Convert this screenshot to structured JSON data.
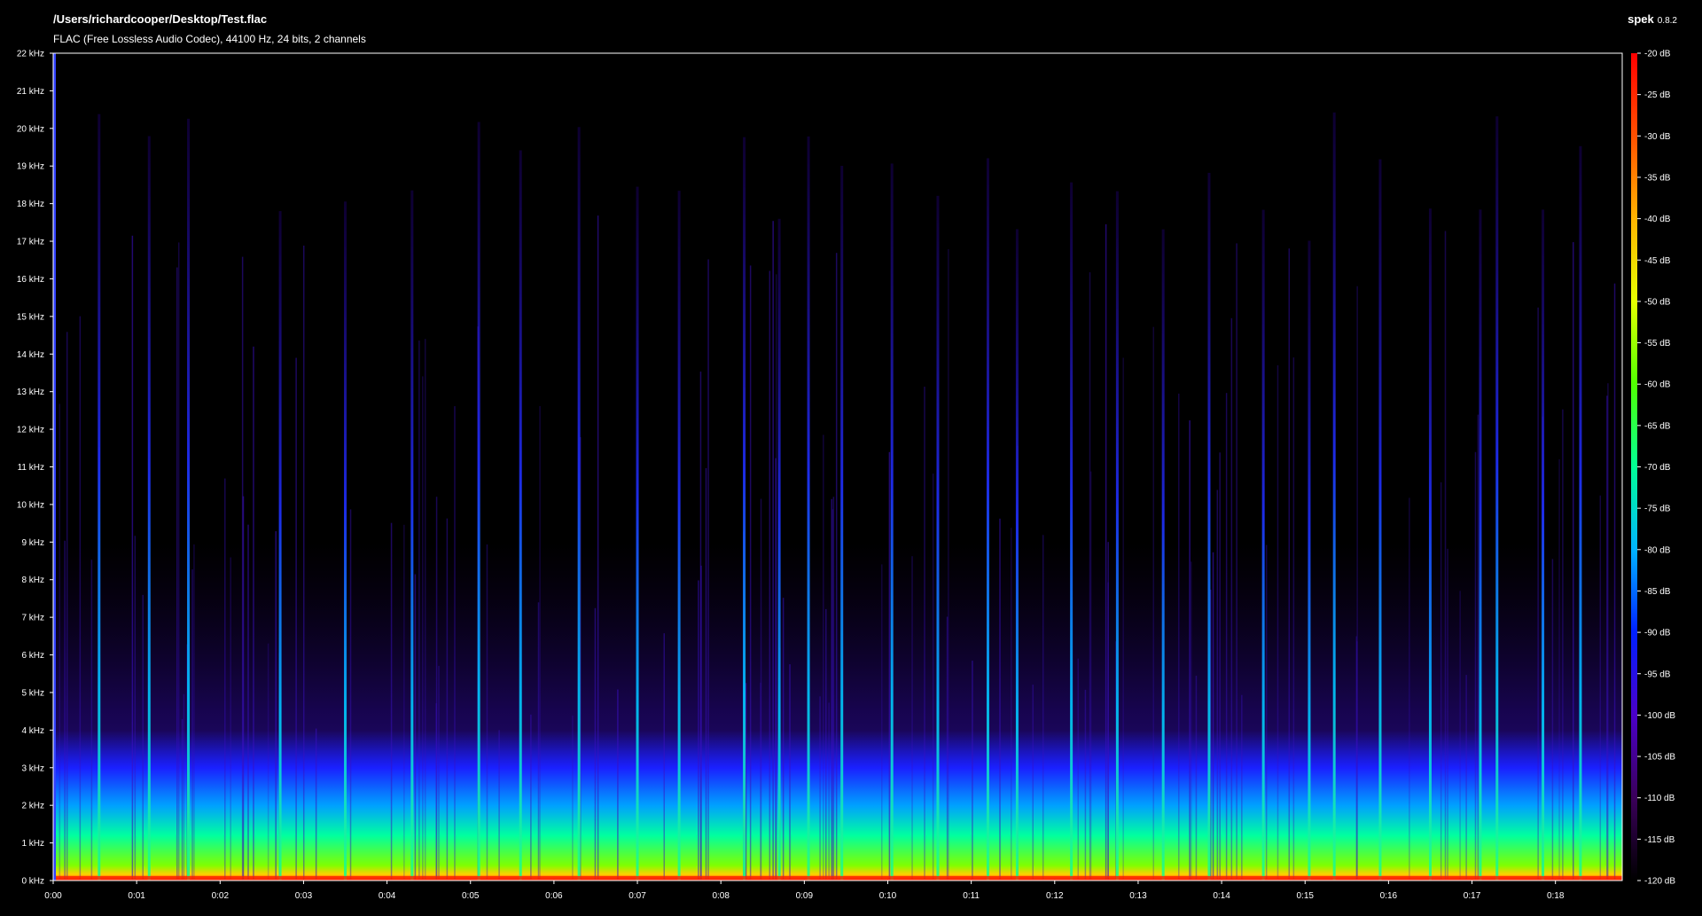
{
  "header": {
    "file_path": "/Users/richardcooper/Desktop/Test.flac",
    "stream_info": "FLAC (Free Lossless Audio Codec), 44100 Hz, 24 bits, 2 channels",
    "app_name": "spek",
    "app_version": "0.8.2"
  },
  "chart_data": {
    "type": "heatmap",
    "title": "",
    "xlabel": "",
    "ylabel": "",
    "x_ticks": [
      "0:00",
      "0:01",
      "0:02",
      "0:03",
      "0:04",
      "0:05",
      "0:06",
      "0:07",
      "0:08",
      "0:09",
      "0:10",
      "0:11",
      "0:12",
      "0:13",
      "0:14",
      "0:15",
      "0:16",
      "0:17",
      "0:18"
    ],
    "x_tick_seconds": [
      0,
      1,
      2,
      3,
      4,
      5,
      6,
      7,
      8,
      9,
      10,
      11,
      12,
      13,
      14,
      15,
      16,
      17,
      18
    ],
    "xlim_seconds": [
      0,
      18.8
    ],
    "y_ticks": [
      "0 kHz",
      "1 kHz",
      "2 kHz",
      "3 kHz",
      "4 kHz",
      "5 kHz",
      "6 kHz",
      "7 kHz",
      "8 kHz",
      "9 kHz",
      "10 kHz",
      "11 kHz",
      "12 kHz",
      "13 kHz",
      "14 kHz",
      "15 kHz",
      "16 kHz",
      "17 kHz",
      "18 kHz",
      "19 kHz",
      "20 kHz",
      "21 kHz",
      "22 kHz"
    ],
    "y_tick_khz": [
      0,
      1,
      2,
      3,
      4,
      5,
      6,
      7,
      8,
      9,
      10,
      11,
      12,
      13,
      14,
      15,
      16,
      17,
      18,
      19,
      20,
      21,
      22
    ],
    "ylim_khz": [
      0,
      22
    ],
    "colorbar": {
      "ticks": [
        "-20 dB",
        "-25 dB",
        "-30 dB",
        "-35 dB",
        "-40 dB",
        "-45 dB",
        "-50 dB",
        "-55 dB",
        "-60 dB",
        "-65 dB",
        "-70 dB",
        "-75 dB",
        "-80 dB",
        "-85 dB",
        "-90 dB",
        "-95 dB",
        "-100 dB",
        "-105 dB",
        "-110 dB",
        "-115 dB",
        "-120 dB"
      ],
      "range_db": [
        -120,
        -20
      ],
      "colors": [
        "#000000",
        "#3a005a",
        "#4b00c8",
        "#0020ff",
        "#00b4ff",
        "#00ff96",
        "#50ff00",
        "#e6ff00",
        "#ffb400",
        "#ff5000",
        "#ff0000"
      ]
    },
    "transients_seconds": [
      0.55,
      1.15,
      1.62,
      2.72,
      3.5,
      4.3,
      5.1,
      5.6,
      6.3,
      7.0,
      7.5,
      8.28,
      8.7,
      9.05,
      9.45,
      10.05,
      10.6,
      11.2,
      11.55,
      12.2,
      12.75,
      13.3,
      13.85,
      14.5,
      15.05,
      15.35,
      15.9,
      16.5,
      17.1,
      17.3,
      17.85,
      18.3
    ],
    "description_level": "energy concentrated below ~3 kHz (green/yellow), red band below ~0.3 kHz; vertical transient streaks reach ~20 kHz"
  }
}
